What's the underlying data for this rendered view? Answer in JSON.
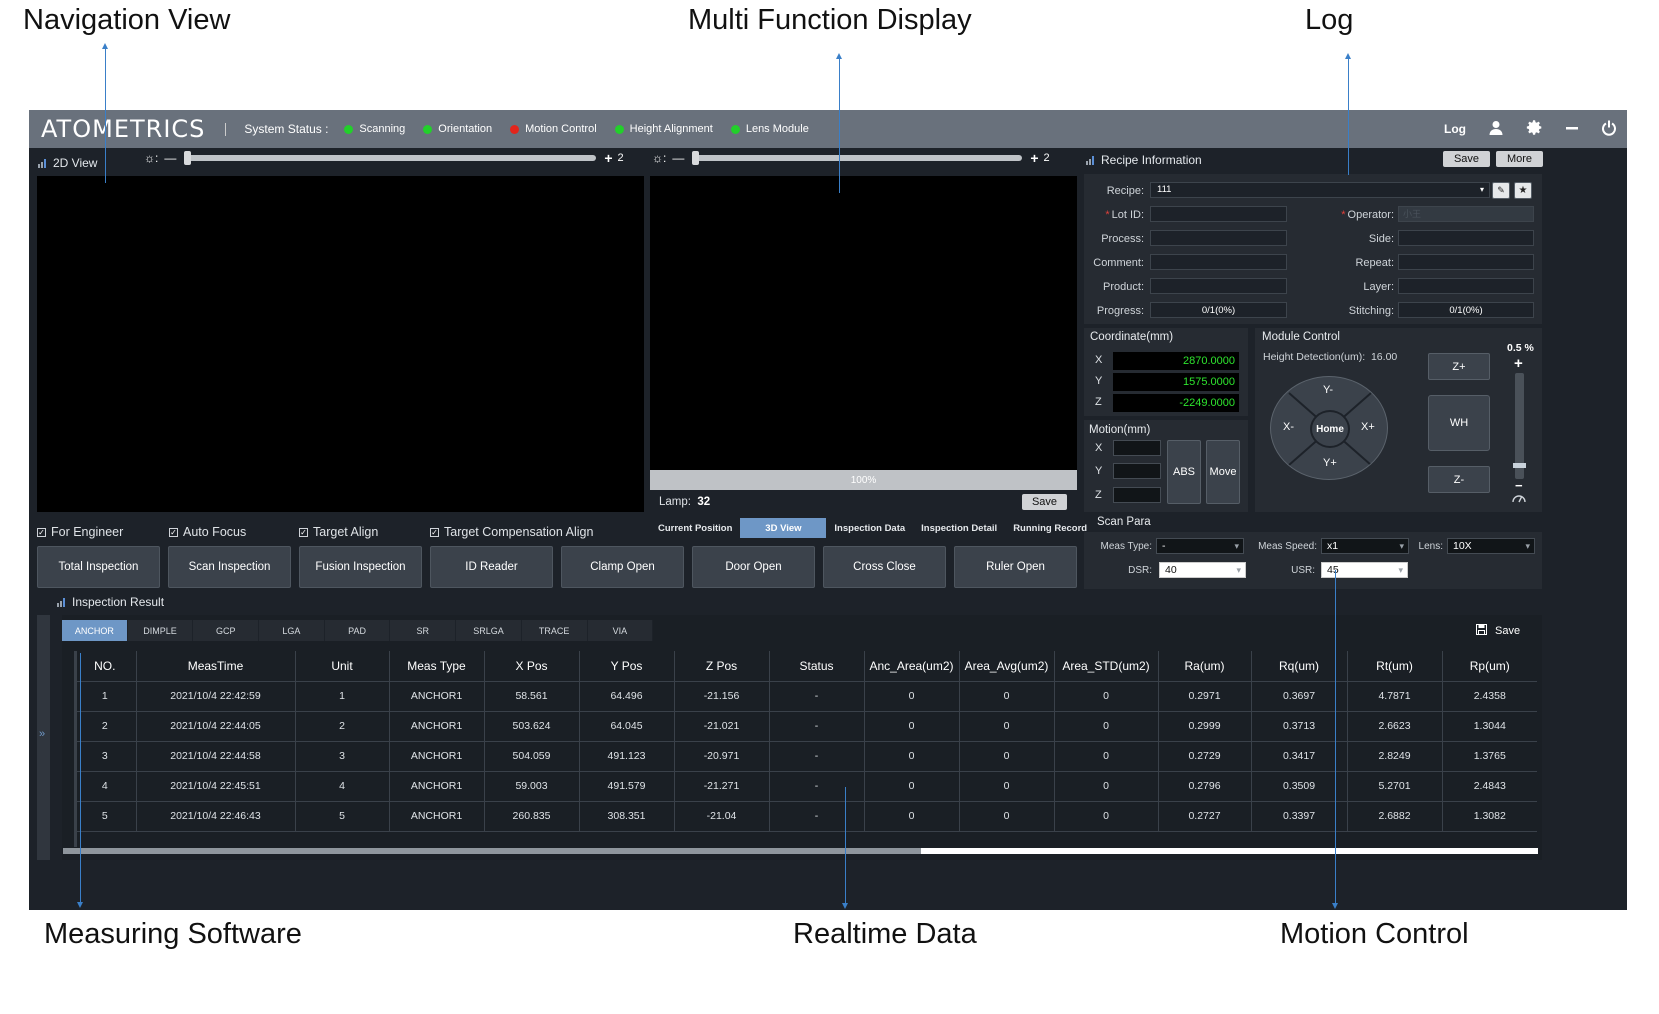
{
  "callouts": {
    "navigation_view": "Navigation View",
    "multi_function_display": "Multi Function Display",
    "log": "Log",
    "measuring_software": "Measuring Software",
    "realtime_data": "Realtime Data",
    "motion_control": "Motion Control"
  },
  "topbar": {
    "logo": "ATOMETRICS",
    "system_status_label": "System Status :",
    "statuses": [
      {
        "label": "Scanning",
        "color": "#22d02a"
      },
      {
        "label": "Orientation",
        "color": "#22d02a"
      },
      {
        "label": "Motion Control",
        "color": "#e3241b"
      },
      {
        "label": "Height Alignment",
        "color": "#22d02a"
      },
      {
        "label": "Lens Module",
        "color": "#22d02a"
      }
    ],
    "log_label": "Log",
    "icons": [
      "user-icon",
      "gear-icon",
      "minimize-icon",
      "power-icon"
    ]
  },
  "nav_view": {
    "title": "2D View",
    "brightness_min": "—",
    "brightness_max": "+",
    "brightness_value": "2"
  },
  "mfd": {
    "brightness_min": "—",
    "brightness_max": "+",
    "brightness_value": "2",
    "progress_text": "100%",
    "lamp_label": "Lamp:",
    "lamp_value": "32",
    "save_label": "Save",
    "tabs": [
      "Current Position",
      "3D View",
      "Inspection Data",
      "Inspection Detail",
      "Running Record"
    ],
    "active_tab": "3D View"
  },
  "options": {
    "for_engineer": "For Engineer",
    "auto_focus": "Auto Focus",
    "target_align": "Target Align",
    "target_comp_align": "Target Compensation Align"
  },
  "actions": [
    "Total  Inspection",
    "Scan  Inspection",
    "Fusion  Inspection",
    "ID  Reader",
    "Clamp  Open",
    "Door  Open",
    "Cross Close",
    "Ruler Open"
  ],
  "recipe": {
    "title": "Recipe Information",
    "save_label": "Save",
    "more_label": "More",
    "recipe_label": "Recipe:",
    "recipe_value": "111",
    "lot_id_label": "Lot ID:",
    "operator_label": "Operator:",
    "operator_placeholder": "小王",
    "process_label": "Process:",
    "side_label": "Side:",
    "comment_label": "Comment:",
    "repeat_label": "Repeat:",
    "product_label": "Product:",
    "layer_label": "Layer:",
    "progress_label": "Progress:",
    "progress_value": "0/1(0%)",
    "stitching_label": "Stitching:",
    "stitching_value": "0/1(0%)"
  },
  "coordinate": {
    "title": "Coordinate(mm)",
    "x_label": "X",
    "x_value": "2870.0000",
    "y_label": "Y",
    "y_value": "1575.0000",
    "z_label": "Z",
    "z_value": "-2249.0000"
  },
  "motion": {
    "title": "Motion(mm)",
    "x_label": "X",
    "y_label": "Y",
    "z_label": "Z",
    "abs_label": "ABS",
    "move_label": "Move"
  },
  "module_control": {
    "title": "Module  Control",
    "height_detection_label": "Height Detection(um):",
    "height_detection_value": "16.00",
    "y_minus": "Y-",
    "y_plus": "Y+",
    "x_minus": "X-",
    "x_plus": "X+",
    "home": "Home",
    "z_plus": "Z+",
    "wh": "WH",
    "z_minus": "Z-",
    "speed_percent": "0.5 %",
    "speed_level": 0.05
  },
  "scan_para": {
    "title": "Scan Para",
    "meas_type_label": "Meas Type:",
    "meas_type_value": "-",
    "meas_speed_label": "Meas Speed:",
    "meas_speed_value": "x1",
    "lens_label": "Lens:",
    "lens_value": "10X",
    "dsr_label": "DSR:",
    "dsr_value": "40",
    "usr_label": "USR:",
    "usr_value": "45"
  },
  "inspection": {
    "title": "Inspection Result",
    "save_label": "Save",
    "tabs": [
      "ANCHOR",
      "DIMPLE",
      "GCP",
      "LGA",
      "PAD",
      "SR",
      "SRLGA",
      "TRACE",
      "VIA"
    ],
    "active_tab": "ANCHOR",
    "columns": [
      "NO.",
      "MeasTime",
      "Unit",
      "Meas Type",
      "X Pos",
      "Y Pos",
      "Z Pos",
      "Status",
      "Anc_Area(um2)",
      "Area_Avg(um2)",
      "Area_STD(um2)",
      "Ra(um)",
      "Rq(um)",
      "Rt(um)",
      "Rp(um)"
    ],
    "rows": [
      [
        "1",
        "2021/10/4 22:42:59",
        "1",
        "ANCHOR1",
        "58.561",
        "64.496",
        "-21.156",
        "-",
        "0",
        "0",
        "0",
        "0.2971",
        "0.3697",
        "4.7871",
        "2.4358"
      ],
      [
        "2",
        "2021/10/4 22:44:05",
        "2",
        "ANCHOR1",
        "503.624",
        "64.045",
        "-21.021",
        "-",
        "0",
        "0",
        "0",
        "0.2999",
        "0.3713",
        "2.6623",
        "1.3044"
      ],
      [
        "3",
        "2021/10/4 22:44:58",
        "3",
        "ANCHOR1",
        "504.059",
        "491.123",
        "-20.971",
        "-",
        "0",
        "0",
        "0",
        "0.2729",
        "0.3417",
        "2.8249",
        "1.3765"
      ],
      [
        "4",
        "2021/10/4 22:45:51",
        "4",
        "ANCHOR1",
        "59.003",
        "491.579",
        "-21.271",
        "-",
        "0",
        "0",
        "0",
        "0.2796",
        "0.3509",
        "5.2701",
        "2.4843"
      ],
      [
        "5",
        "2021/10/4 22:46:43",
        "5",
        "ANCHOR1",
        "260.835",
        "308.351",
        "-21.04",
        "-",
        "0",
        "0",
        "0",
        "0.2727",
        "0.3397",
        "2.6882",
        "1.3082"
      ]
    ],
    "expand_glyph": "»"
  }
}
